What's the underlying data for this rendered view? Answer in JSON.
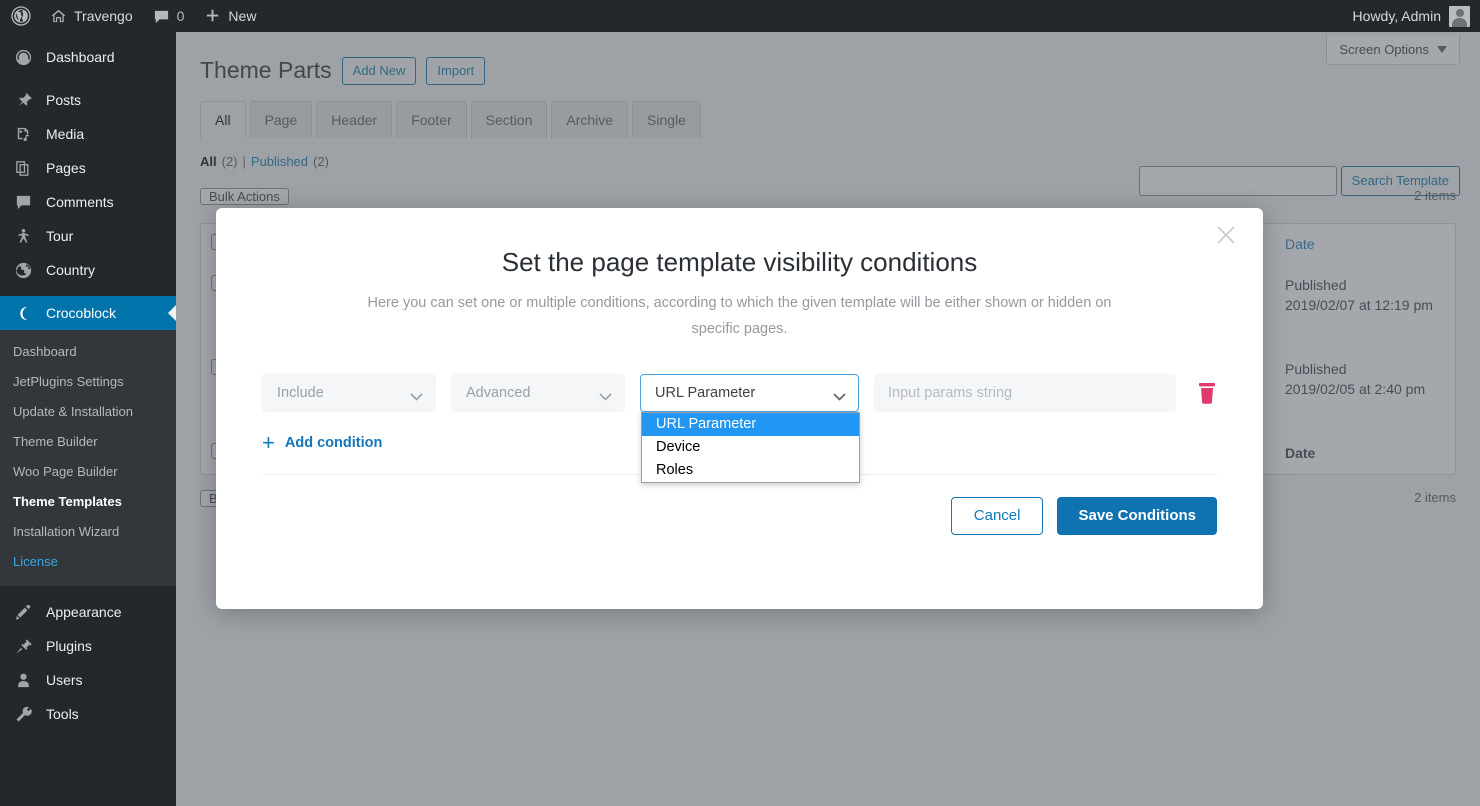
{
  "adminbar": {
    "site_name": "Travengo",
    "comment_count": "0",
    "new_label": "New",
    "howdy": "Howdy, Admin",
    "icons": {
      "wp": "wordpress-logo-icon",
      "home": "home-icon",
      "comment": "comment-bubble-icon",
      "plus": "plus-icon"
    }
  },
  "sidebar": {
    "items": [
      {
        "label": "Dashboard",
        "icon": "dashboard-icon"
      },
      {
        "label": "Posts",
        "icon": "pin-icon"
      },
      {
        "label": "Media",
        "icon": "media-icon"
      },
      {
        "label": "Pages",
        "icon": "pages-icon"
      },
      {
        "label": "Comments",
        "icon": "comment-bubble-icon"
      },
      {
        "label": "Tour",
        "icon": "person-icon"
      },
      {
        "label": "Country",
        "icon": "globe-icon"
      },
      {
        "label": "Crocoblock",
        "icon": "crocoblock-icon"
      }
    ],
    "submenu": [
      {
        "label": "Dashboard"
      },
      {
        "label": "JetPlugins Settings"
      },
      {
        "label": "Update & Installation"
      },
      {
        "label": "Theme Builder"
      },
      {
        "label": "Woo Page Builder"
      },
      {
        "label": "Theme Templates"
      },
      {
        "label": "Installation Wizard"
      },
      {
        "label": "License"
      }
    ],
    "bottom_items": [
      {
        "label": "Appearance",
        "icon": "brush-icon"
      },
      {
        "label": "Plugins",
        "icon": "plug-icon"
      },
      {
        "label": "Users",
        "icon": "user-icon"
      },
      {
        "label": "Tools",
        "icon": "wrench-icon"
      }
    ]
  },
  "page": {
    "screen_options": "Screen Options",
    "title": "Theme Parts",
    "add_new": "Add New",
    "import": "Import",
    "tabs": [
      {
        "label": "All"
      },
      {
        "label": "Page"
      },
      {
        "label": "Header"
      },
      {
        "label": "Footer"
      },
      {
        "label": "Section"
      },
      {
        "label": "Archive"
      },
      {
        "label": "Single"
      }
    ],
    "filters": {
      "all_label": "All",
      "all_count": "(2)",
      "separator": "|",
      "published_label": "Published",
      "published_count": "(2)"
    },
    "search": {
      "value": "",
      "placeholder": "",
      "button": "Search Template"
    },
    "bulk_actions_label": "Bulk Actions",
    "items_count_top": "2 items",
    "items_count_bottom": "2 items",
    "table": {
      "columns": {
        "date": "Date"
      },
      "rows": [
        {
          "date_status": "Published",
          "date_value": "2019/02/07 at 12:19 pm"
        },
        {
          "date_status": "Published",
          "date_value": "2019/02/05 at 2:40 pm"
        }
      ]
    }
  },
  "modal": {
    "title": "Set the page template visibility conditions",
    "description": "Here you can set one or multiple conditions, according to which the given template will be either shown or hidden on specific pages.",
    "close_icon": "close-icon",
    "condition": {
      "type_value": "Include",
      "group_value": "Advanced",
      "rule_value": "URL Parameter",
      "params_placeholder": "Input params string",
      "params_value": "",
      "delete_icon": "trash-icon"
    },
    "dropdown_options": [
      {
        "label": "URL Parameter",
        "selected": true
      },
      {
        "label": "Device",
        "selected": false
      },
      {
        "label": "Roles",
        "selected": false
      }
    ],
    "add_condition": "Add condition",
    "cancel": "Cancel",
    "save": "Save Conditions"
  },
  "colors": {
    "admin_bar": "#23282d",
    "sidebar": "#23282d",
    "accent_blue": "#0073aa",
    "link_blue": "#2271b1",
    "save_button": "#0f72b1",
    "dropdown_highlight": "#2196f3",
    "trash_pink": "#e0396b"
  }
}
